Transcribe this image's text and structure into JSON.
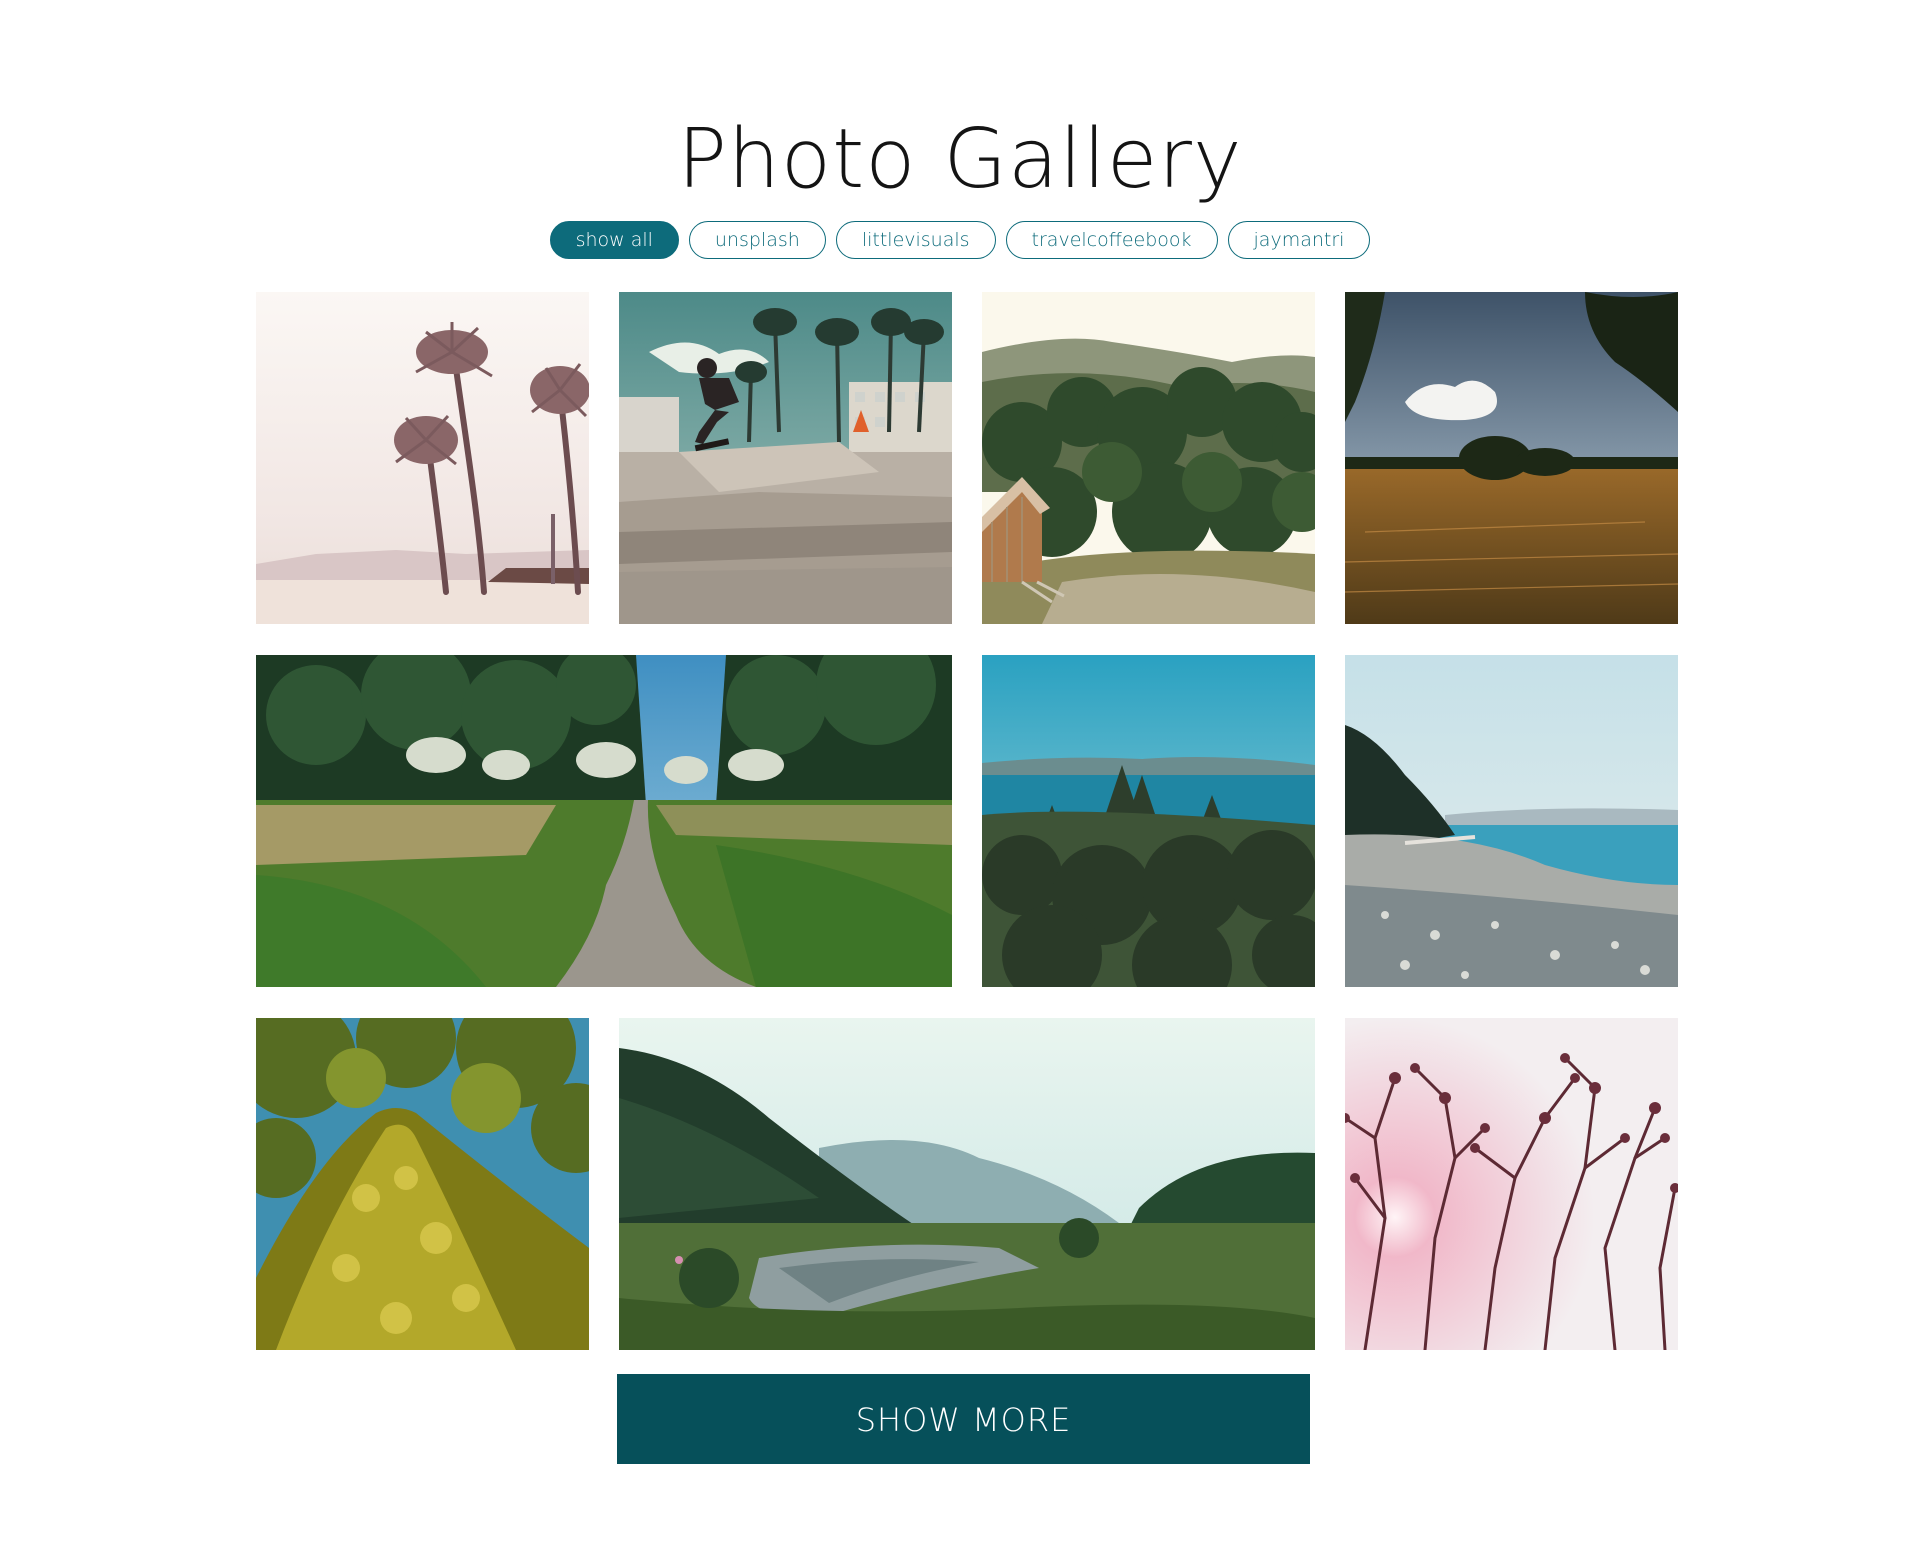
{
  "header": {
    "title": "Photo Gallery"
  },
  "filters": [
    {
      "label": "show all",
      "active": true
    },
    {
      "label": "unsplash",
      "active": false
    },
    {
      "label": "littlevisuals",
      "active": false
    },
    {
      "label": "travelcoffeebook",
      "active": false
    },
    {
      "label": "jaymantri",
      "active": false
    }
  ],
  "gallery": {
    "photos": [
      {
        "subject": "palm trees on beach"
      },
      {
        "subject": "skateboarder in skate park"
      },
      {
        "subject": "forest hillside with wooden shed"
      },
      {
        "subject": "wheat field under cloudy sky"
      },
      {
        "subject": "dirt path through meadow"
      },
      {
        "subject": "ocean view over pine forest"
      },
      {
        "subject": "pebble beach shoreline"
      },
      {
        "subject": "mossy tree trunk"
      },
      {
        "subject": "misty valley with river"
      },
      {
        "subject": "flowering branches silhouette"
      }
    ]
  },
  "footer": {
    "show_more_label": "SHOW MORE"
  },
  "colors": {
    "accent": "#0d6b7b",
    "button": "#06505a",
    "background": "#ffffff"
  }
}
